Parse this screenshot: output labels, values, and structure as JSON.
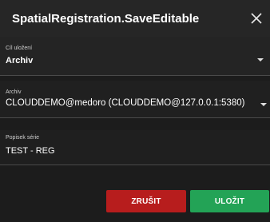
{
  "dialog": {
    "title": "SpatialRegistration.SaveEditable"
  },
  "fields": {
    "location": {
      "label": "Cíl uložení",
      "value": "Archiv"
    },
    "archive": {
      "label": "Archiv",
      "value": "CLOUDDEMO@medoro (CLOUDDEMO@127.0.0.1:5380)"
    },
    "series": {
      "label": "Popisek série",
      "value": "TEST - REG"
    }
  },
  "buttons": {
    "cancel_label": "ZRUŠIT",
    "save_label": "ULOŽIT"
  },
  "colors": {
    "cancel": "#b71d1d",
    "save": "#23a356"
  }
}
